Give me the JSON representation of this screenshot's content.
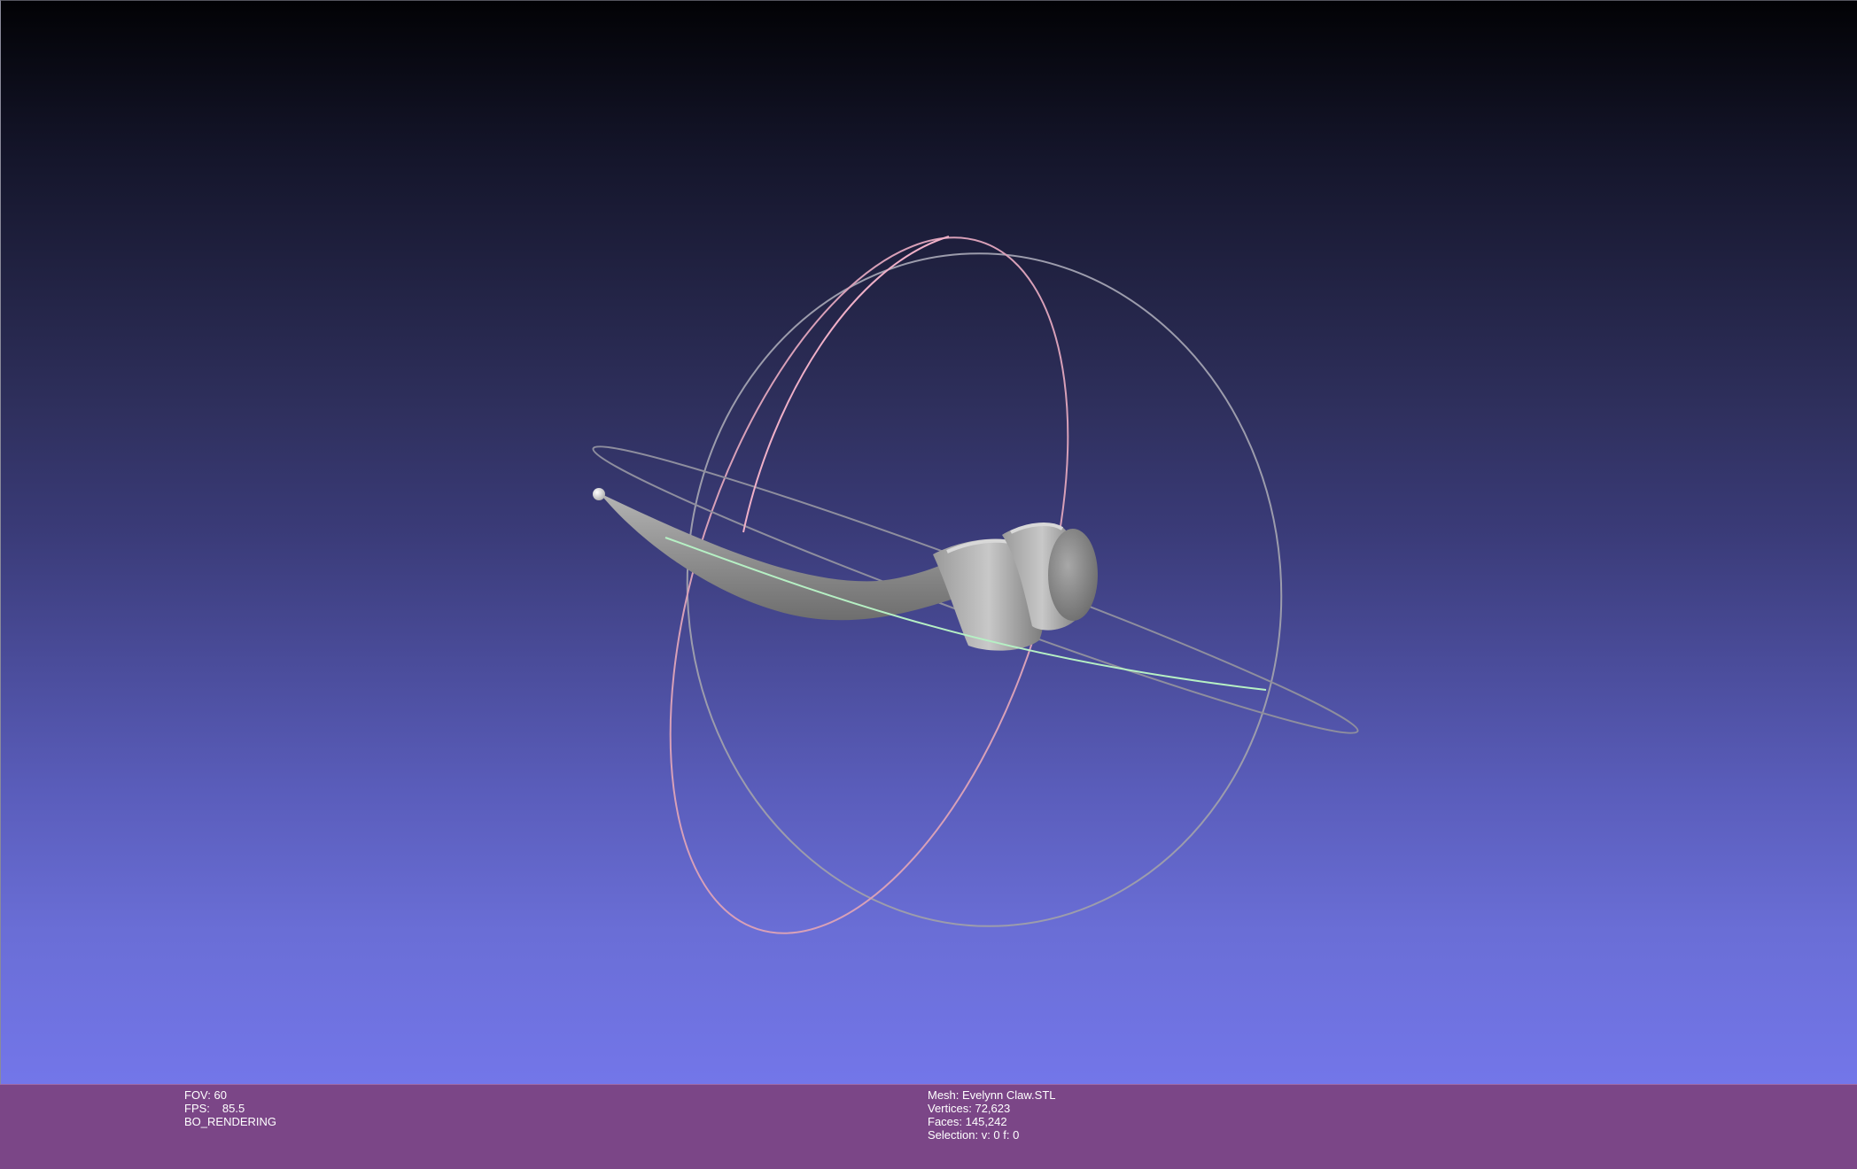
{
  "viewport": {
    "background_top": "#020205",
    "background_bottom": "#7376e9",
    "mesh_color": "#8c8c8c",
    "trackball": {
      "ring_color_gray": "#a0a0a8",
      "ring_color_pink": "#f0a0b8",
      "ring_color_green": "#b8f0c0"
    }
  },
  "infobar": {
    "background": "#7b4687",
    "left": {
      "fov": "FOV: 60",
      "fps_label": "FPS:",
      "fps_value": "85.5",
      "render_mode": "BO_RENDERING"
    },
    "right": {
      "mesh": "Mesh: Evelynn Claw.STL",
      "vertices": "Vertices: 72,623",
      "faces": "Faces: 145,242",
      "selection": "Selection: v: 0 f: 0"
    }
  }
}
